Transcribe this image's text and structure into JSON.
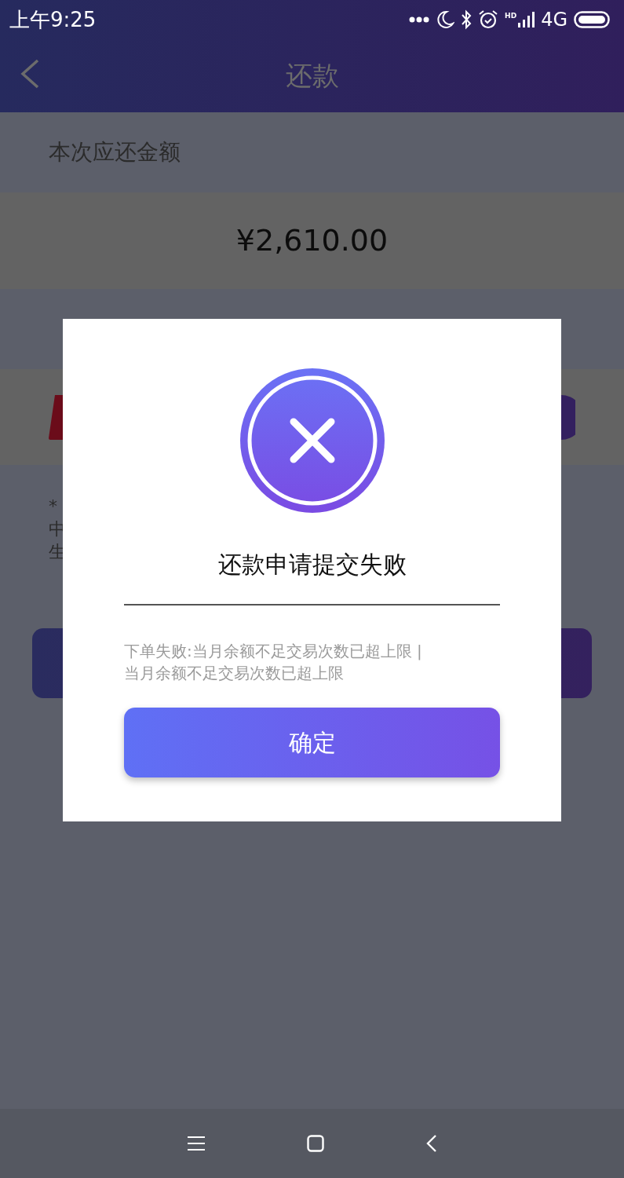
{
  "status_bar": {
    "time": "上午9:25",
    "hd": "HD",
    "network": "4G"
  },
  "nav": {
    "title": "还款"
  },
  "due": {
    "label": "本次应还金额",
    "amount": "¥2,610.00"
  },
  "notes": [
    "*",
    "中",
    "生"
  ],
  "dialog": {
    "title": "还款申请提交失败",
    "message": "下单失败:当月余额不足交易次数已超上限 | 当月余额不足交易次数已超上限",
    "button": "确定"
  }
}
